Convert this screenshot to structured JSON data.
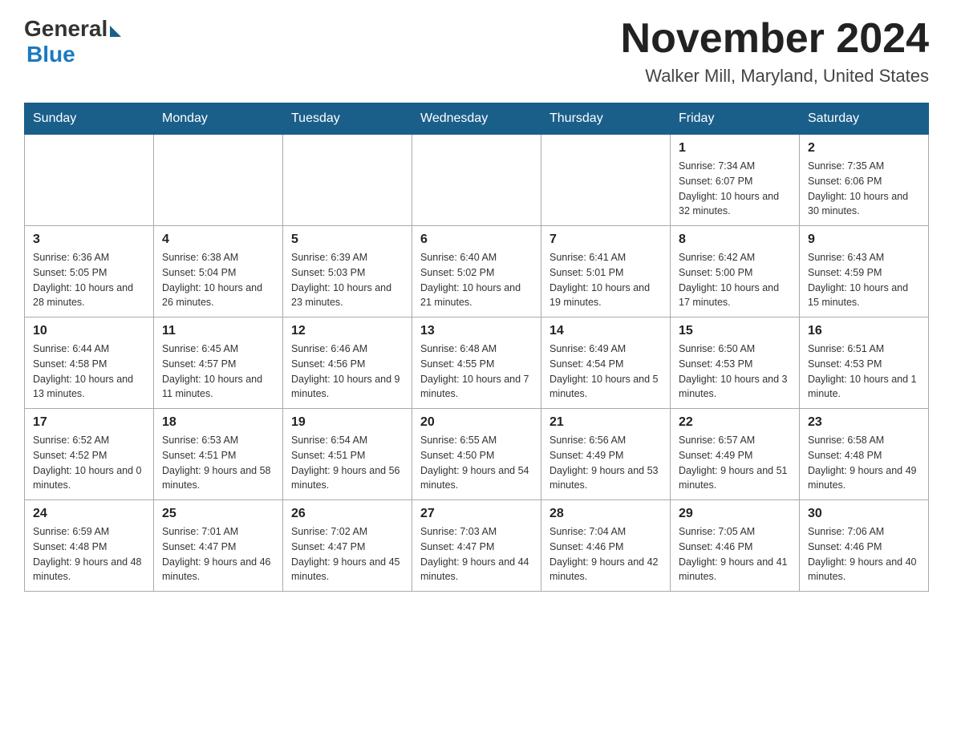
{
  "header": {
    "logo_general": "General",
    "logo_blue": "Blue",
    "month_year": "November 2024",
    "location": "Walker Mill, Maryland, United States"
  },
  "days_of_week": [
    "Sunday",
    "Monday",
    "Tuesday",
    "Wednesday",
    "Thursday",
    "Friday",
    "Saturday"
  ],
  "weeks": [
    [
      {
        "day": "",
        "info": ""
      },
      {
        "day": "",
        "info": ""
      },
      {
        "day": "",
        "info": ""
      },
      {
        "day": "",
        "info": ""
      },
      {
        "day": "",
        "info": ""
      },
      {
        "day": "1",
        "info": "Sunrise: 7:34 AM\nSunset: 6:07 PM\nDaylight: 10 hours and 32 minutes."
      },
      {
        "day": "2",
        "info": "Sunrise: 7:35 AM\nSunset: 6:06 PM\nDaylight: 10 hours and 30 minutes."
      }
    ],
    [
      {
        "day": "3",
        "info": "Sunrise: 6:36 AM\nSunset: 5:05 PM\nDaylight: 10 hours and 28 minutes."
      },
      {
        "day": "4",
        "info": "Sunrise: 6:38 AM\nSunset: 5:04 PM\nDaylight: 10 hours and 26 minutes."
      },
      {
        "day": "5",
        "info": "Sunrise: 6:39 AM\nSunset: 5:03 PM\nDaylight: 10 hours and 23 minutes."
      },
      {
        "day": "6",
        "info": "Sunrise: 6:40 AM\nSunset: 5:02 PM\nDaylight: 10 hours and 21 minutes."
      },
      {
        "day": "7",
        "info": "Sunrise: 6:41 AM\nSunset: 5:01 PM\nDaylight: 10 hours and 19 minutes."
      },
      {
        "day": "8",
        "info": "Sunrise: 6:42 AM\nSunset: 5:00 PM\nDaylight: 10 hours and 17 minutes."
      },
      {
        "day": "9",
        "info": "Sunrise: 6:43 AM\nSunset: 4:59 PM\nDaylight: 10 hours and 15 minutes."
      }
    ],
    [
      {
        "day": "10",
        "info": "Sunrise: 6:44 AM\nSunset: 4:58 PM\nDaylight: 10 hours and 13 minutes."
      },
      {
        "day": "11",
        "info": "Sunrise: 6:45 AM\nSunset: 4:57 PM\nDaylight: 10 hours and 11 minutes."
      },
      {
        "day": "12",
        "info": "Sunrise: 6:46 AM\nSunset: 4:56 PM\nDaylight: 10 hours and 9 minutes."
      },
      {
        "day": "13",
        "info": "Sunrise: 6:48 AM\nSunset: 4:55 PM\nDaylight: 10 hours and 7 minutes."
      },
      {
        "day": "14",
        "info": "Sunrise: 6:49 AM\nSunset: 4:54 PM\nDaylight: 10 hours and 5 minutes."
      },
      {
        "day": "15",
        "info": "Sunrise: 6:50 AM\nSunset: 4:53 PM\nDaylight: 10 hours and 3 minutes."
      },
      {
        "day": "16",
        "info": "Sunrise: 6:51 AM\nSunset: 4:53 PM\nDaylight: 10 hours and 1 minute."
      }
    ],
    [
      {
        "day": "17",
        "info": "Sunrise: 6:52 AM\nSunset: 4:52 PM\nDaylight: 10 hours and 0 minutes."
      },
      {
        "day": "18",
        "info": "Sunrise: 6:53 AM\nSunset: 4:51 PM\nDaylight: 9 hours and 58 minutes."
      },
      {
        "day": "19",
        "info": "Sunrise: 6:54 AM\nSunset: 4:51 PM\nDaylight: 9 hours and 56 minutes."
      },
      {
        "day": "20",
        "info": "Sunrise: 6:55 AM\nSunset: 4:50 PM\nDaylight: 9 hours and 54 minutes."
      },
      {
        "day": "21",
        "info": "Sunrise: 6:56 AM\nSunset: 4:49 PM\nDaylight: 9 hours and 53 minutes."
      },
      {
        "day": "22",
        "info": "Sunrise: 6:57 AM\nSunset: 4:49 PM\nDaylight: 9 hours and 51 minutes."
      },
      {
        "day": "23",
        "info": "Sunrise: 6:58 AM\nSunset: 4:48 PM\nDaylight: 9 hours and 49 minutes."
      }
    ],
    [
      {
        "day": "24",
        "info": "Sunrise: 6:59 AM\nSunset: 4:48 PM\nDaylight: 9 hours and 48 minutes."
      },
      {
        "day": "25",
        "info": "Sunrise: 7:01 AM\nSunset: 4:47 PM\nDaylight: 9 hours and 46 minutes."
      },
      {
        "day": "26",
        "info": "Sunrise: 7:02 AM\nSunset: 4:47 PM\nDaylight: 9 hours and 45 minutes."
      },
      {
        "day": "27",
        "info": "Sunrise: 7:03 AM\nSunset: 4:47 PM\nDaylight: 9 hours and 44 minutes."
      },
      {
        "day": "28",
        "info": "Sunrise: 7:04 AM\nSunset: 4:46 PM\nDaylight: 9 hours and 42 minutes."
      },
      {
        "day": "29",
        "info": "Sunrise: 7:05 AM\nSunset: 4:46 PM\nDaylight: 9 hours and 41 minutes."
      },
      {
        "day": "30",
        "info": "Sunrise: 7:06 AM\nSunset: 4:46 PM\nDaylight: 9 hours and 40 minutes."
      }
    ]
  ]
}
